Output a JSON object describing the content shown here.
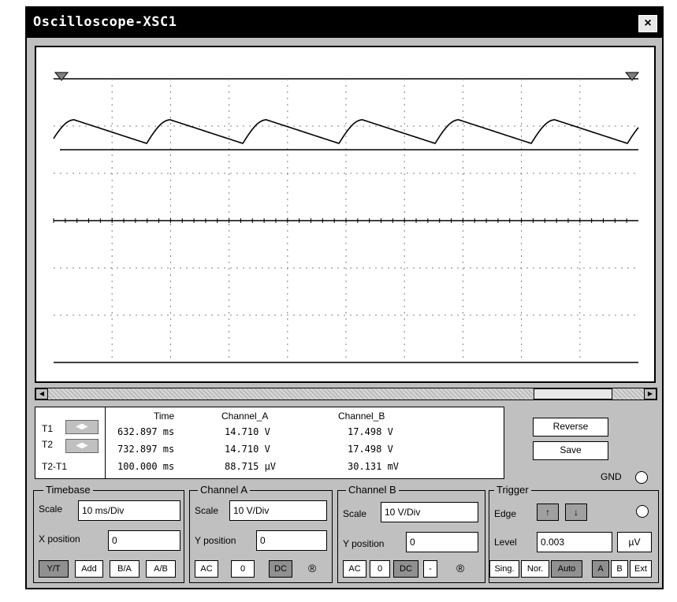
{
  "window": {
    "title": "Oscilloscope-XSC1",
    "close_label": "×"
  },
  "screen": {
    "trace_color": "#000000",
    "grid_color": "#808080"
  },
  "readout": {
    "headers": {
      "time": "Time",
      "channel_a": "Channel_A",
      "channel_b": "Channel_B"
    },
    "rows": [
      {
        "label": "T1",
        "time": "632.897 ms",
        "channel_a": "14.710 V",
        "channel_b": "17.498 V"
      },
      {
        "label": "T2",
        "time": "732.897 ms",
        "channel_a": "14.710 V",
        "channel_b": "17.498 V"
      },
      {
        "label": "T2-T1",
        "time": "100.000 ms",
        "channel_a": "88.715 µV",
        "channel_b": "30.131 mV"
      }
    ]
  },
  "actions": {
    "reverse": "Reverse",
    "save": "Save",
    "gnd": "GND"
  },
  "timebase": {
    "label": "Timebase",
    "scale_label": "Scale",
    "scale_value": "10 ms/Div",
    "xpos_label": "X position",
    "xpos_value": "0",
    "modes": [
      "Y/T",
      "Add",
      "B/A",
      "A/B"
    ]
  },
  "channel_a": {
    "label": "Channel A",
    "scale_label": "Scale",
    "scale_value": "10  V/Div",
    "ypos_label": "Y position",
    "ypos_value": "0",
    "coupling": [
      "AC",
      "0",
      "DC"
    ],
    "extra": "®"
  },
  "channel_b": {
    "label": "Channel B",
    "scale_label": "Scale",
    "scale_value": "10  V/Div",
    "ypos_label": "Y position",
    "ypos_value": "0",
    "coupling": [
      "AC",
      "0",
      "DC",
      "-"
    ],
    "extra": "®"
  },
  "trigger": {
    "label": "Trigger",
    "edge_label": "Edge",
    "edge_rise": "↑",
    "edge_fall": "↓",
    "level_label": "Level",
    "level_value": "0.003",
    "level_unit": "µV",
    "modes": [
      "Sing.",
      "Nor.",
      "Auto"
    ],
    "sources": [
      "A",
      "B",
      "Ext"
    ]
  }
}
